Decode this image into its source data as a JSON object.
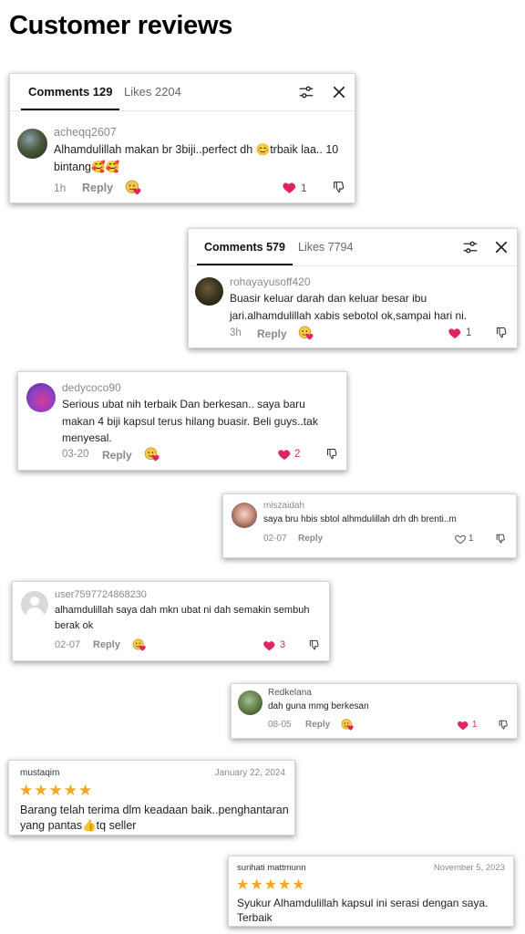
{
  "page": {
    "title": "Customer reviews"
  },
  "cards": {
    "c1": {
      "comments_tab": "Comments 129",
      "likes_tab": "Likes 2204",
      "user": "acheqq2607",
      "text": "Alhamdulillah makan br 3biji..perfect dh 😊trbaik laa.. 10 bintang🥰🥰",
      "time": "1h",
      "reply": "Reply",
      "likes": "1"
    },
    "c2": {
      "comments_tab": "Comments 579",
      "likes_tab": "Likes 7794",
      "user": "rohayayusoff420",
      "text": "Buasir keluar darah dan keluar besar ibu jari.alhamdulillah xabis sebotol ok,sampai hari ni.",
      "time": "3h",
      "reply": "Reply",
      "likes": "1"
    },
    "c3": {
      "user": "dedycoco90",
      "text": "Serious ubat nih terbaik Dan berkesan.. saya baru makan 4 biji kapsul terus hilang buasir. Beli guys..tak menyesal.",
      "time": "03-20",
      "reply": "Reply",
      "likes": "2"
    },
    "c4": {
      "user": "miszaidah",
      "text": "saya bru hbis sbtol alhmdulillah drh dh brenti..m",
      "time": "02-07",
      "reply": "Reply",
      "likes": "1"
    },
    "c5": {
      "user": "user7597724868230",
      "text": "alhamdulillah saya dah mkn ubat ni dah semakin sembuh berak ok",
      "time": "02-07",
      "reply": "Reply",
      "likes": "3"
    },
    "c6": {
      "user": "Redkelana",
      "text": "dah guna mmg berkesan",
      "time": "08-05",
      "reply": "Reply",
      "likes": "1"
    }
  },
  "reviews": {
    "r1": {
      "name": "mustaqim",
      "date": "January 22, 2024",
      "stars": "★★★★★",
      "rating": 5,
      "text": "Barang telah terima dlm keadaan baik..penghantaran yang pantas👍tq seller"
    },
    "r2": {
      "name": "surihati mattmunn",
      "date": "November 5, 2023",
      "stars": "★★★★★",
      "rating": 5,
      "text": "Syukur Alhamdulillah kapsul ini serasi dengan saya. Terbaik"
    }
  },
  "colors": {
    "heart_red": "#e0245e",
    "star_orange": "#f5a623",
    "muted": "#8a8a8a"
  },
  "icons": {
    "filter": "filter-sliders-icon",
    "close": "close-icon",
    "heart": "heart-icon",
    "dislike": "thumbs-down-icon",
    "emoji": "emoji-love-icon"
  }
}
